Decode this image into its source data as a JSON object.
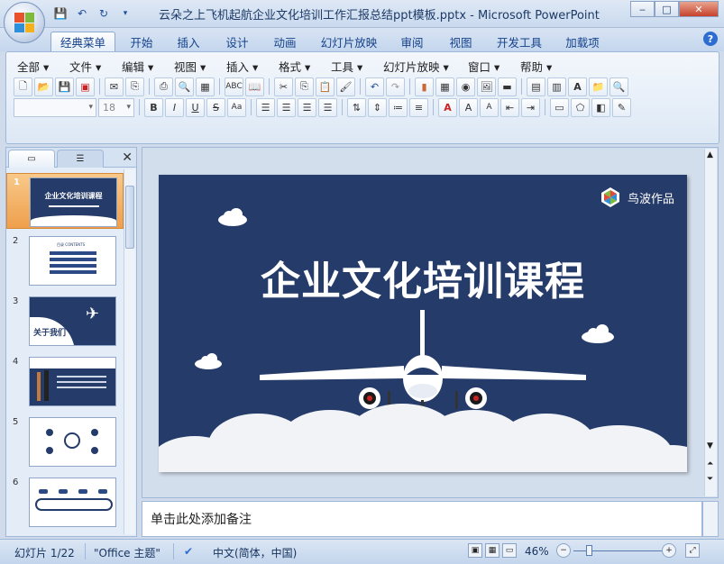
{
  "window": {
    "title": "云朵之上飞机起航企业文化培训工作汇报总结ppt模板.pptx - Microsoft PowerPoint"
  },
  "ribbon_tabs": [
    "经典菜单",
    "开始",
    "插入",
    "设计",
    "动画",
    "幻灯片放映",
    "审阅",
    "视图",
    "开发工具",
    "加载项"
  ],
  "menu": [
    "全部",
    "文件",
    "编辑",
    "视图",
    "插入",
    "格式",
    "工具",
    "幻灯片放映",
    "窗口",
    "帮助"
  ],
  "font_size": "18",
  "slides": {
    "numbers": [
      "1",
      "2",
      "3",
      "4",
      "5",
      "6"
    ],
    "thumb1_title": "企业文化培训课程",
    "thumb2_title": "目录 CONTENTS",
    "thumb3_title": "关于我们"
  },
  "slide": {
    "title": "企业文化培训课程",
    "brand": "鸟波作品",
    "background": "#253b69"
  },
  "notes_placeholder": "单击此处添加备注",
  "status": {
    "slide_counter": "幻灯片 1/22",
    "theme": "\"Office 主题\"",
    "language": "中文(简体，中国)",
    "zoom": "46%"
  },
  "colors": {
    "accent": "#2e6dd0",
    "selected": "#ef9f4c"
  }
}
